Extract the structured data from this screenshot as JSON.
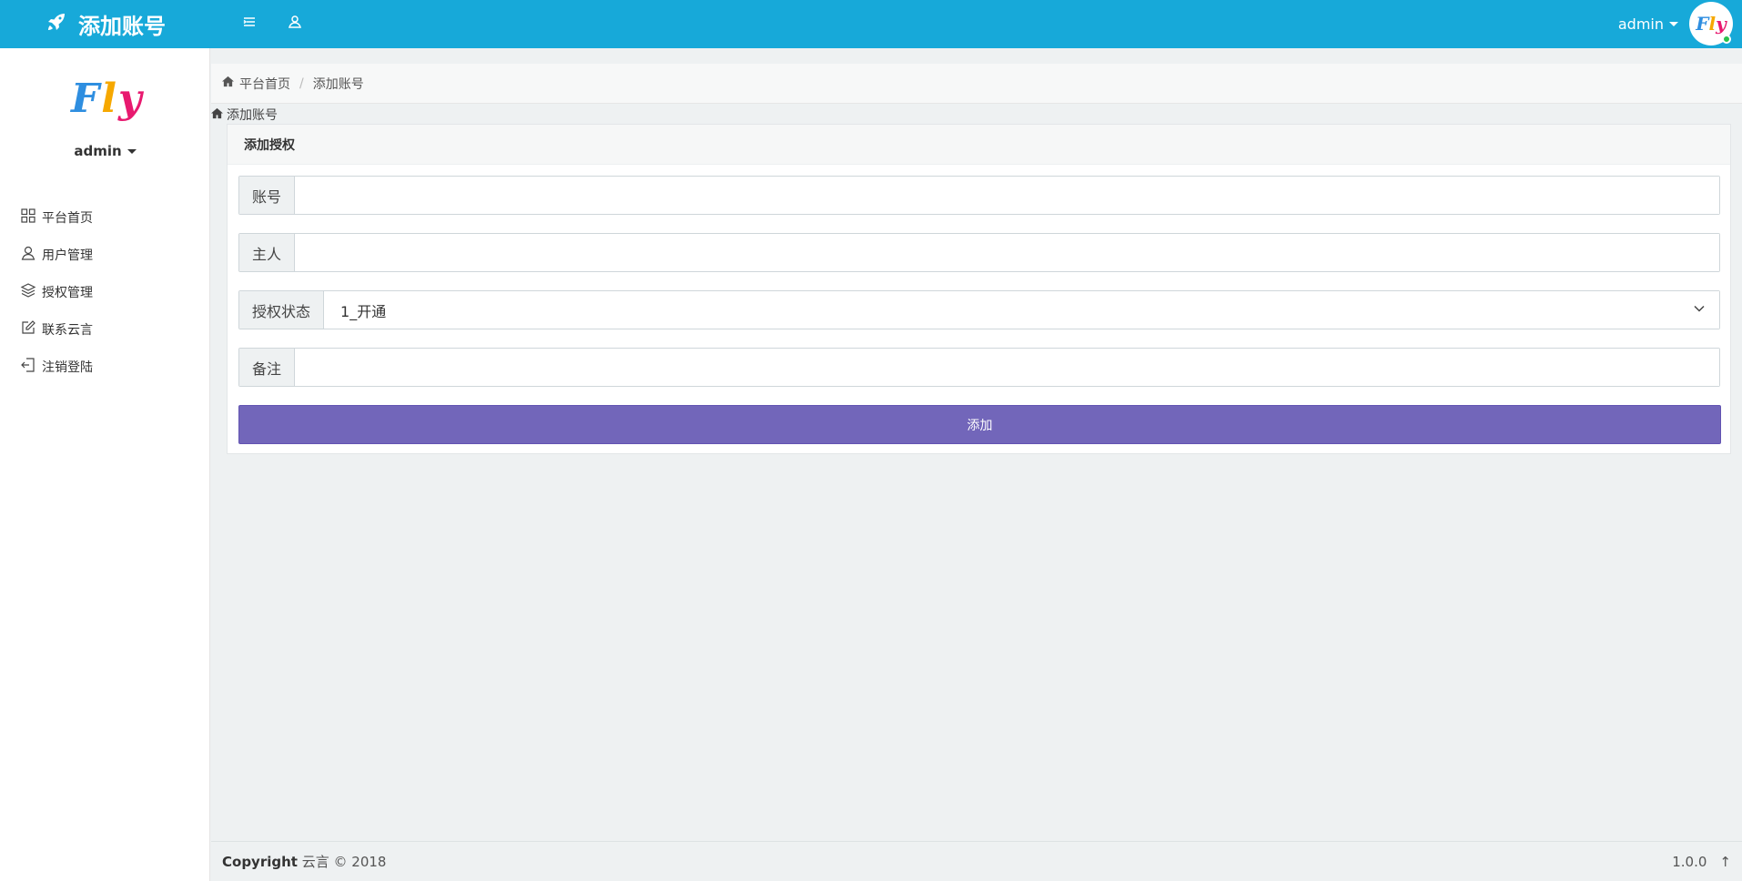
{
  "topbar": {
    "title": "添加账号",
    "username": "admin",
    "avatar_text": "Fly",
    "bg_color": "#17a9d9"
  },
  "sidebar": {
    "logo": {
      "f": "F",
      "l": "l",
      "y": "y"
    },
    "username": "admin",
    "items": [
      {
        "label": "平台首页",
        "icon": "grid-icon"
      },
      {
        "label": "用户管理",
        "icon": "user-icon"
      },
      {
        "label": "授权管理",
        "icon": "layers-icon"
      },
      {
        "label": "联系云言",
        "icon": "edit-icon"
      },
      {
        "label": "注销登陆",
        "icon": "logout-icon"
      }
    ]
  },
  "breadcrumb": {
    "home": "平台首页",
    "current": "添加账号",
    "sub": "添加账号"
  },
  "panel": {
    "title": "添加授权",
    "fields": {
      "account_label": "账号",
      "account_value": "",
      "owner_label": "主人",
      "owner_value": "",
      "status_label": "授权状态",
      "status_value": "1_开通",
      "remark_label": "备注",
      "remark_value": ""
    },
    "submit_label": "添加",
    "button_color": "#7266ba"
  },
  "footer": {
    "copyright_bold": "Copyright",
    "copyright_text": " 云言 © 2018",
    "version": "1.0.0",
    "up_arrow": "↑"
  }
}
